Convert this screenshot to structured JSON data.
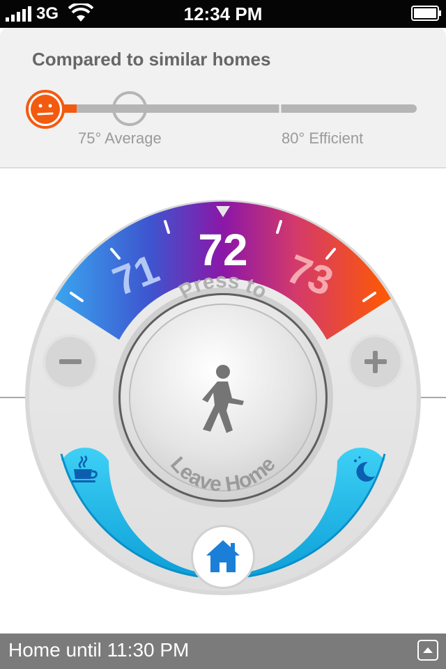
{
  "status_bar": {
    "network": "3G",
    "time": "12:34 PM"
  },
  "comparison": {
    "title": "Compared to similar homes",
    "average_label": "75° Average",
    "efficient_label": "80° Efficient",
    "indicator": "face-neutral-icon"
  },
  "dial": {
    "current_temp": "72",
    "lower_temp": "71",
    "higher_temp": "73",
    "center_top_text": "Press to",
    "center_bottom_text": "Leave Home",
    "minus_label": "−",
    "plus_label": "+",
    "icons": {
      "center": "walking-person-icon",
      "morning": "coffee-cup-icon",
      "night": "moon-stars-icon",
      "home": "home-icon"
    }
  },
  "footer": {
    "status_text": "Home until 11:30 PM",
    "expand_icon": "chevron-up-icon"
  },
  "colors": {
    "accent_orange": "#f25a10",
    "scale_blue": "#2d8fe0",
    "scale_purple": "#8b17a8",
    "scale_red": "#f2470d",
    "schedule_cyan": "#14b8e8",
    "home_blue": "#1b7fd8"
  }
}
